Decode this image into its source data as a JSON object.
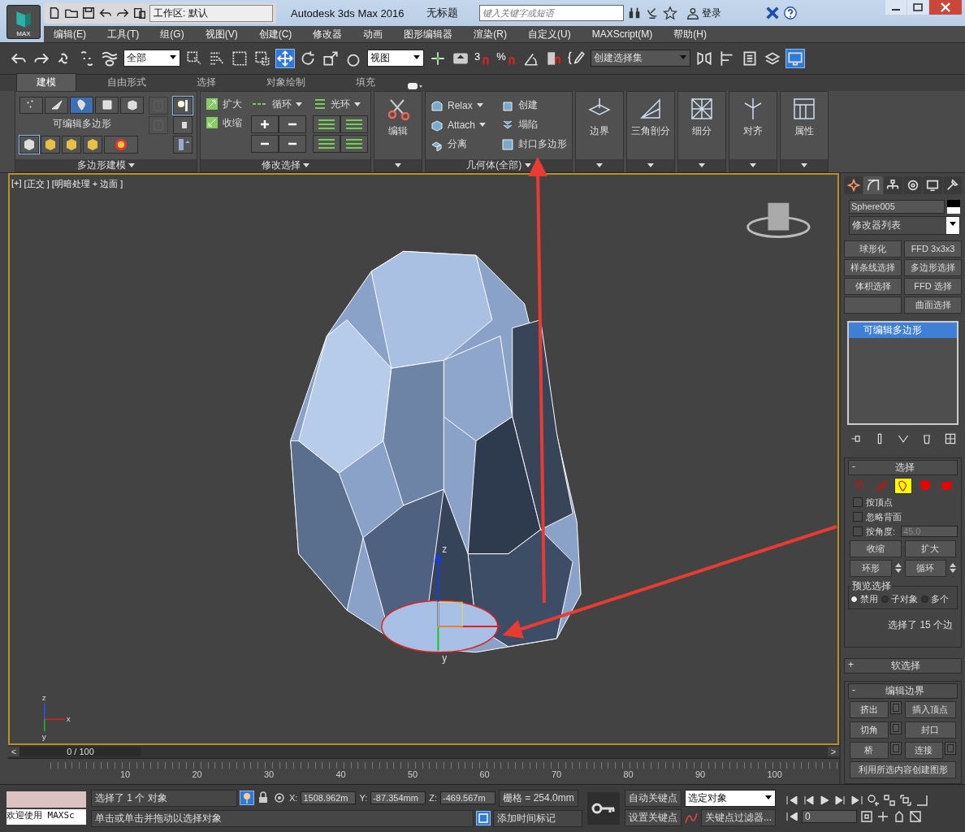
{
  "app_button": {
    "label": "MAX"
  },
  "quick_access": {
    "workspace": "工作区: 默认"
  },
  "window": {
    "app_title": "Autodesk 3ds Max 2016",
    "document_title": "无标题"
  },
  "search": {
    "placeholder": "键入关键字或短语"
  },
  "account": {
    "sign_in": "登录"
  },
  "menu": [
    "编辑(E)",
    "工具(T)",
    "组(G)",
    "视图(V)",
    "创建(C)",
    "修改器",
    "动画",
    "图形编辑器",
    "渲染(R)",
    "自定义(U)",
    "MAXScript(M)",
    "帮助(H)"
  ],
  "toolbar": {
    "selection_filter": "全部",
    "reference_coord": "视图",
    "snap_labels": [
      "3",
      "%"
    ],
    "named_selection_placeholder": "创建选择集"
  },
  "ribbon": {
    "tabs": [
      {
        "label": "建模",
        "selected": true
      },
      {
        "label": "自由形式",
        "selected": false
      },
      {
        "label": "选择",
        "selected": false
      },
      {
        "label": "对象绘制",
        "selected": false
      },
      {
        "label": "填充",
        "selected": false
      }
    ],
    "polygon_modeling": {
      "title": "多边形建模",
      "subobjects": [
        {
          "selected": false
        },
        {
          "selected": false
        },
        {
          "selected": true
        },
        {
          "selected": false
        },
        {
          "selected": false
        }
      ],
      "object_label": "可编辑多边形"
    },
    "modify_selection": {
      "title": "修改选择",
      "grow": "扩大",
      "shrink": "收缩",
      "loop": "循环",
      "ring": "光环"
    },
    "edit": {
      "label": "编辑"
    },
    "geometry": {
      "title": "几何体(全部)",
      "items": [
        "Relax",
        "Attach",
        "分离",
        "创建",
        "塌陷",
        "封口多边形"
      ]
    },
    "big_panels": [
      "边界",
      "三角剖分",
      "细分",
      "对齐",
      "属性"
    ]
  },
  "viewport": {
    "labels": [
      "[+]",
      "[正交 ]",
      "[明暗处理 + 边面 ]"
    ],
    "gizmo_axes": [
      "z",
      "y"
    ],
    "corner_axes": [
      "z",
      "x",
      "y"
    ]
  },
  "command_panel": {
    "tabs": [
      {
        "selected": false
      },
      {
        "selected": true
      },
      {
        "selected": false
      },
      {
        "selected": false
      },
      {
        "selected": false
      },
      {
        "selected": false
      }
    ],
    "object_name": "Sphere005",
    "modifier_list": "修改器列表",
    "modifier_buttons": [
      {
        "left": "球形化",
        "right": "FFD 3x3x3"
      },
      {
        "left": "样条线选择",
        "right": "多边形选择"
      },
      {
        "left": "体积选择",
        "right": "FFD 选择"
      },
      {
        "right": "曲面选择"
      }
    ],
    "stack": [
      {
        "label": "可编辑多边形",
        "selected": true
      }
    ],
    "selection": {
      "toggle": "-",
      "title": "选择",
      "subobjects": [
        {
          "selected": false
        },
        {
          "selected": false
        },
        {
          "selected": true
        },
        {
          "selected": false
        },
        {
          "selected": false
        }
      ],
      "checks": [
        {
          "label": "按顶点",
          "checked": false
        },
        {
          "label": "忽略背面",
          "checked": false
        },
        {
          "label": "按角度:",
          "checked": false,
          "value": "45.0"
        }
      ],
      "shrink": "收缩",
      "grow": "扩大",
      "ring": "环形",
      "loop": "循环",
      "preview": {
        "title": "预览选择",
        "options": [
          {
            "label": "禁用",
            "selected": true
          },
          {
            "label": "子对象",
            "selected": false
          },
          {
            "label": "多个",
            "selected": false
          }
        ]
      },
      "status": "选择了 15 个边"
    },
    "soft_selection": {
      "toggle": "+",
      "title": "软选择"
    },
    "edit_borders": {
      "toggle": "-",
      "title": "编辑边界",
      "buttons": [
        {
          "label": "挤出",
          "settings": true
        },
        {
          "label": "插入顶点",
          "settings": false
        },
        {
          "label": "切角",
          "settings": true
        },
        {
          "label": "封口",
          "settings": false
        },
        {
          "label": "桥",
          "settings": true
        },
        {
          "label": "连接",
          "settings": true
        }
      ],
      "create_shape": "利用所选内容创建图形"
    }
  },
  "timeline": {
    "prev": "<",
    "frame": "0 / 100",
    "level": 0,
    "next": ">",
    "ticks": [
      "10",
      "20",
      "30",
      "40",
      "50",
      "60",
      "70",
      "80",
      "90",
      "100"
    ]
  },
  "status_bar": {
    "listener": "欢迎使用 MAXSc",
    "selected": "选择了 1 个 对象",
    "prompt": "单击或单击并拖动以选择对象",
    "x_label": "X:",
    "x": "1508.962m",
    "y_label": "Y:",
    "y": "-87.354mm",
    "z_label": "Z:",
    "z": "-469.567m",
    "grid": "栅格 = 254.0mm",
    "time_tag": "添加时间标记",
    "auto_key": "自动关键点",
    "set_key": "设置关键点",
    "key_mode": "选定对象",
    "key_filters": "关键点过滤器...",
    "current_frame": "0"
  }
}
